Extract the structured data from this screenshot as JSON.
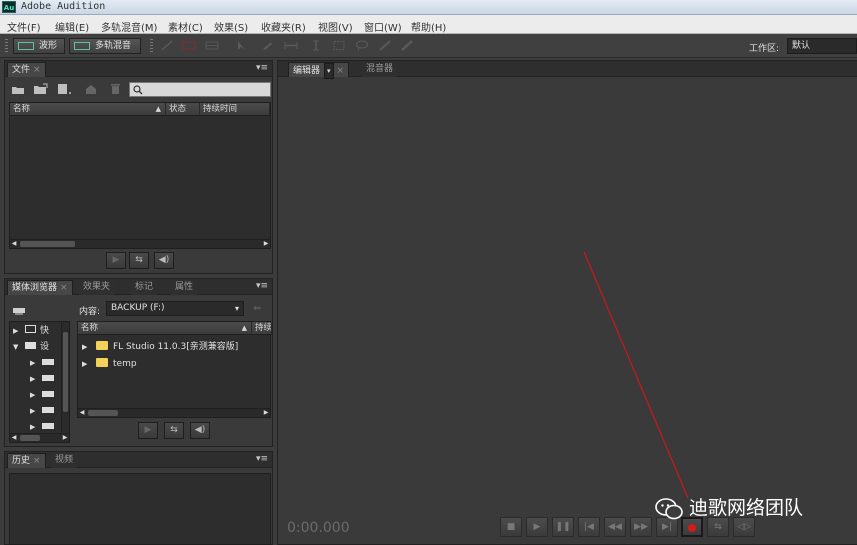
{
  "window": {
    "app_icon": "Au",
    "title": "Adobe Audition"
  },
  "menu": [
    "文件(F)",
    "编辑(E)",
    "多轨混音(M)",
    "素材(C)",
    "效果(S)",
    "收藏夹(R)",
    "视图(V)",
    "窗口(W)",
    "帮助(H)"
  ],
  "toolbar": {
    "waveform_label": "波形",
    "multitrack_label": "多轨混音",
    "workspace_label": "工作区:",
    "workspace_value": "默认"
  },
  "files_panel": {
    "tab": "文件",
    "search_placeholder": "",
    "columns": [
      "名称",
      "状态",
      "持续时间"
    ]
  },
  "media_panel": {
    "tabs": [
      "媒体浏览器",
      "效果夹",
      "标记",
      "属性"
    ],
    "content_label": "内容:",
    "content_value": "BACKUP (F:)",
    "tree": [
      "快",
      "设"
    ],
    "list_columns": [
      "名称",
      "持续"
    ],
    "items": [
      "FL Studio 11.0.3[亲测兼容版]",
      "temp"
    ]
  },
  "history_panel": {
    "tabs": [
      "历史",
      "视频"
    ]
  },
  "editor": {
    "tabs": [
      "编辑器",
      "混音器"
    ],
    "time": "0:00.000"
  },
  "watermark": {
    "text": "迪歌网络团队"
  },
  "colors": {
    "accent_record": "#d11c1c",
    "annotation_line": "#c41a1a",
    "folder": "#f2d15a"
  }
}
